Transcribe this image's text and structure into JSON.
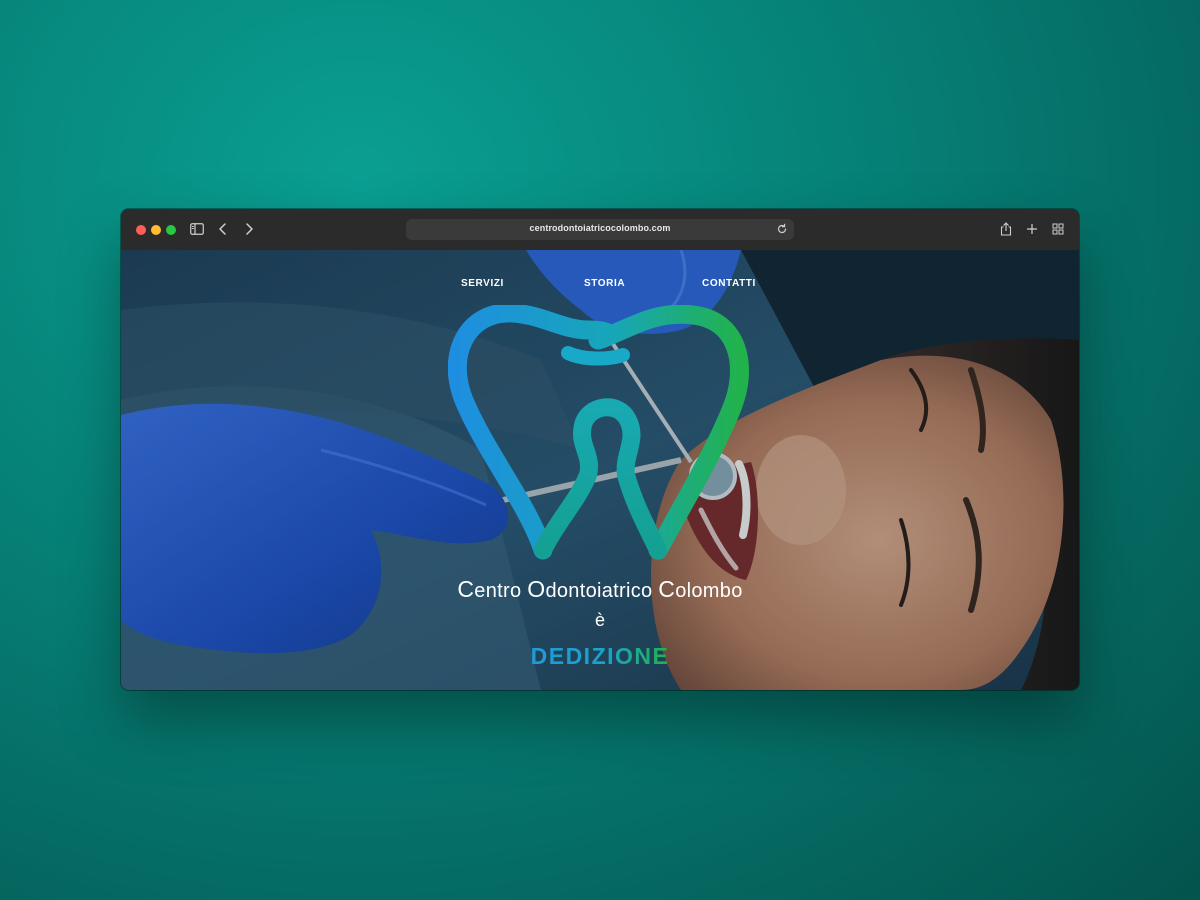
{
  "browser": {
    "url": "centrodontoiatricocolombo.com"
  },
  "nav": {
    "items": [
      "SERVIZI",
      "STORIA",
      "CONTATTI"
    ]
  },
  "hero": {
    "brand": {
      "c1": "C",
      "w1": "entro ",
      "c2": "O",
      "w2": "dontoiatrico ",
      "c3": "C",
      "w3": "olombo"
    },
    "verb": "è",
    "word": "DEDIZIONE"
  },
  "colors": {
    "logo_blue": "#1e9bd6",
    "logo_green": "#22b24c",
    "page_background": "#067f75"
  },
  "icons": [
    "sidebar-icon",
    "back-icon",
    "forward-icon",
    "reload-icon",
    "share-icon",
    "new-tab-icon",
    "tab-overview-icon",
    "tooth-logo-icon"
  ]
}
